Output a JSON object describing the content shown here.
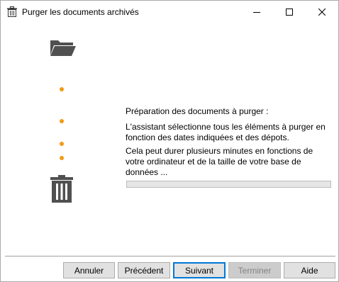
{
  "window": {
    "title": "Purger les documents archivés",
    "title_icon": "trash-icon",
    "controls": {
      "minimize": "minimize-icon",
      "maximize": "maximize-icon",
      "close": "close-icon"
    }
  },
  "illustration": {
    "top_icon": "open-folder-icon",
    "bottom_icon": "trash-icon",
    "dot_color": "#f29a15",
    "icon_color": "#505050"
  },
  "content": {
    "heading": "Préparation des documents à purger :",
    "paragraph1": "L'assistant sélectionne tous les éléments à purger en fonction des dates indiquées et des dépots.",
    "paragraph2": "Cela peut durer plusieurs minutes en fonctions de votre ordinateur et de la taille de votre base de données ...",
    "progress_percent": 0
  },
  "buttons": {
    "cancel": "Annuler",
    "previous": "Précédent",
    "next": "Suivant",
    "finish": "Terminer",
    "help": "Aide"
  }
}
